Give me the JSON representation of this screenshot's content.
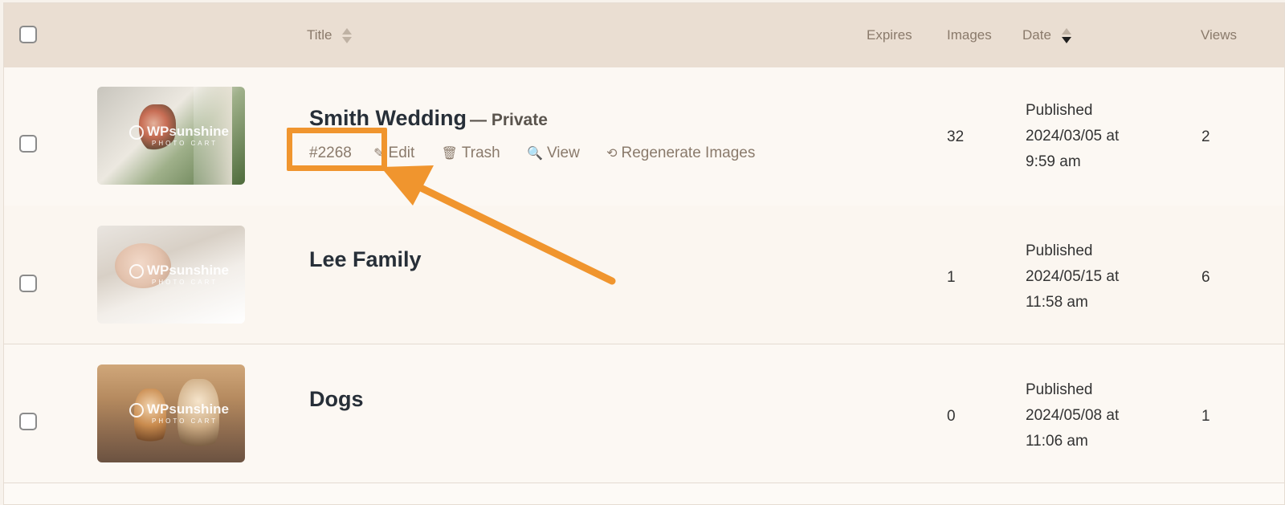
{
  "header": {
    "title_label": "Title",
    "expires_label": "Expires",
    "images_label": "Images",
    "date_label": "Date",
    "views_label": "Views"
  },
  "rows": [
    {
      "title": "Smith Wedding",
      "status": "— Private",
      "id_label": "#2268",
      "actions": {
        "edit": "Edit",
        "trash": "Trash",
        "view": "View",
        "regenerate": "Regenerate Images"
      },
      "images": "32",
      "date_status": "Published",
      "date_day": "2024/03/05 at",
      "date_time": "9:59 am",
      "views": "2"
    },
    {
      "title": "Lee Family",
      "images": "1",
      "date_status": "Published",
      "date_day": "2024/05/15 at",
      "date_time": "11:58 am",
      "views": "6"
    },
    {
      "title": "Dogs",
      "images": "0",
      "date_status": "Published",
      "date_day": "2024/05/08 at",
      "date_time": "11:06 am",
      "views": "1"
    }
  ],
  "watermark": {
    "brand": "WPsunshine",
    "sub": "PHOTO CART"
  },
  "colors": {
    "highlight": "#f0952e",
    "header_bg": "#eaded2",
    "row_bg": "#fcf8f3"
  },
  "icons": {
    "edit": "pencil-icon",
    "trash": "trash-icon",
    "view": "view-icon",
    "regenerate": "regenerate-icon"
  }
}
